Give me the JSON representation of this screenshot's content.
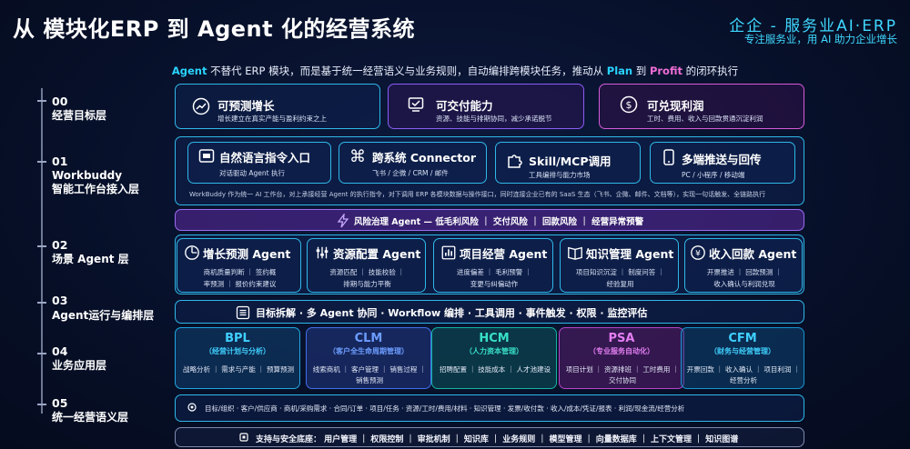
{
  "header": {
    "title": "从 模块化ERP 到 Agent 化的经营系统",
    "brand": "企企 - 服务业AI·ERP",
    "brand_sub": "专注服务业，用 AI 助力企业增长"
  },
  "subtitle": {
    "p1": "Agent",
    "p2": " 不替代 ERP 模块，而是基于统一经营语义与业务规则，自动编排跨模块任务，推动从 ",
    "p3": "Plan",
    "p4": " 到 ",
    "p5": "Profit",
    "p6": " 的闭环执行"
  },
  "layers": [
    {
      "num": "00",
      "name": "经营目标层"
    },
    {
      "num": "01",
      "name": "Workbuddy\n智能工作台接入层"
    },
    {
      "num": "02",
      "name": "场景 Agent 层"
    },
    {
      "num": "03",
      "name": "Agent运行与编排层"
    },
    {
      "num": "04",
      "name": "业务应用层"
    },
    {
      "num": "05",
      "name": "统一经营语义层"
    }
  ],
  "goals": [
    {
      "title": "可预测增长",
      "desc": "增长建立在真实产能与盈利约束之上",
      "icon": "growth-chart-icon"
    },
    {
      "title": "可交付能力",
      "desc": "资源、技能与排期协同，减少承诺脱节",
      "icon": "delivery-check-icon"
    },
    {
      "title": "可兑现利润",
      "desc": "工时、费用、收入与回款贯通沉淀利润",
      "icon": "dollar-coin-icon"
    }
  ],
  "workbuddy": {
    "items": [
      {
        "title": "自然语言指令入口",
        "desc": "对话驱动 Agent 执行",
        "icon": "chat-window-icon"
      },
      {
        "title": "跨系统 Connector",
        "desc": "飞书 / 企微 / CRM / 邮件",
        "icon": "command-key-icon"
      },
      {
        "title": "Skill/MCP调用",
        "desc": "工具编排与能力市场",
        "icon": "puzzle-icon"
      },
      {
        "title": "多端推送与回传",
        "desc": "PC / 小程序 / 移动端",
        "icon": "mobile-phone-icon"
      }
    ],
    "note": "WorkBuddy 作为统一 AI 工作台，对上承接经营 Agent 的执行指令，对下调用 ERP 各模块数据与操作接口，同时连接企业已有的 SaaS 生态（飞书、企微、邮件、文档等），实现一句话触发、全链路执行"
  },
  "risk_bar": {
    "text": "风险治理 Agent — 低毛利风险 ｜ 交付风险 ｜ 回款风险 ｜ 经营异常预警",
    "icon": "lightning-icon"
  },
  "agents": [
    {
      "title": "增长预测 Agent",
      "desc": "商机质量判断 ｜ 签约概\n率预测 ｜ 报价约束建议",
      "icon": "pie-clock-icon"
    },
    {
      "title": "资源配置 Agent",
      "desc": "资源匹配 ｜ 技能校验 ｜\n排期与能力平衡",
      "icon": "sliders-icon"
    },
    {
      "title": "项目经营 Agent",
      "desc": "进度偏差 ｜ 毛利预警 ｜\n变更与纠偏动作",
      "icon": "bar-chart-icon"
    },
    {
      "title": "知识管理 Agent",
      "desc": "项目知识沉淀 ｜ 制度问答 ｜\n经验复用",
      "icon": "open-book-icon"
    },
    {
      "title": "收入回款 Agent",
      "desc": "开票推进 ｜ 回款预测 ｜\n收入确认与利润兑现",
      "icon": "yen-coin-icon"
    }
  ],
  "orchestration": {
    "text": "目标拆解 · 多 Agent 协同 · Workflow 编排 · 工具调用 · 事件触发 · 权限 · 监控评估",
    "icon": "list-icon"
  },
  "apps": [
    {
      "title": "BPL",
      "sub": "（经营计划与分析）",
      "desc": "战略分析 ｜ 需求与产能 ｜ 预算预测",
      "color": "#1fa6e0",
      "text_color": "#3fd0ff"
    },
    {
      "title": "CLM",
      "sub": "（客户全生命周期管理）",
      "desc": "线索商机 ｜ 客户管理 ｜ 销售过程 ｜ 销售预测",
      "color": "#3f6fe8",
      "text_color": "#6c9dff"
    },
    {
      "title": "HCM",
      "sub": "（人力资本管理）",
      "desc": "招聘配置 ｜ 技能成本 ｜ 人才池建设",
      "color": "#15b3a3",
      "text_color": "#38e0c8"
    },
    {
      "title": "PSA",
      "sub": "（专业服务自动化）",
      "desc": "项目计划 ｜ 资源排班 ｜ 工时费用 ｜ 交付协同",
      "color": "#b545c8",
      "text_color": "#e37ef2"
    },
    {
      "title": "CFM",
      "sub": "（财务与经营管理）",
      "desc": "开票回款 ｜ 收入确认 ｜ 项目利润 ｜ 经营分析",
      "color": "#1695cf",
      "text_color": "#3fd0ff"
    }
  ],
  "semantic_bar": {
    "text": "目标/组织 · 客户/供应商 · 商机/采购需求 · 合同/订单 · 项目/任务 · 资源/工时/费用/材料 · 知识管理 · 发票/收付款 · 收入/成本/凭证/报表 · 利润/现金流/经营分析"
  },
  "support_bar": {
    "text": "支持与安全底座： 用户管理 ｜ 权限控制 ｜ 审批机制 ｜ 知识库 ｜ 业务规则 ｜ 模型管理 ｜ 向量数据库 ｜ 上下文管理 ｜ 知识图谱"
  }
}
